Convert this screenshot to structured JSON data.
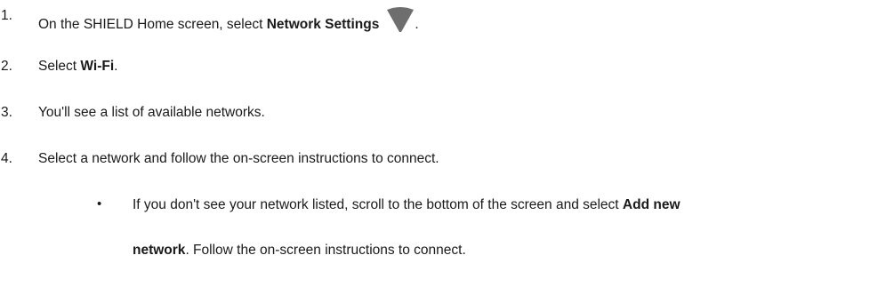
{
  "steps": [
    {
      "num": "1.",
      "pre": "On the SHIELD Home screen, select ",
      "bold": "Network Settings",
      "post": "."
    },
    {
      "num": "2.",
      "pre": "Select ",
      "bold": "Wi-Fi",
      "post": "."
    },
    {
      "num": "3.",
      "text": "You'll see a list of available networks."
    },
    {
      "num": "4.",
      "text": "Select a network and follow the on-screen instructions to connect."
    }
  ],
  "bullet": {
    "marker": "•",
    "line1_pre": "If you don't see your network listed, scroll to the bottom of the screen and select ",
    "line1_bold": "Add new",
    "line2_bold": "network",
    "line2_post": ".  Follow the on-screen instructions to connect."
  },
  "icons": {
    "network_settings": "wifi-icon"
  }
}
